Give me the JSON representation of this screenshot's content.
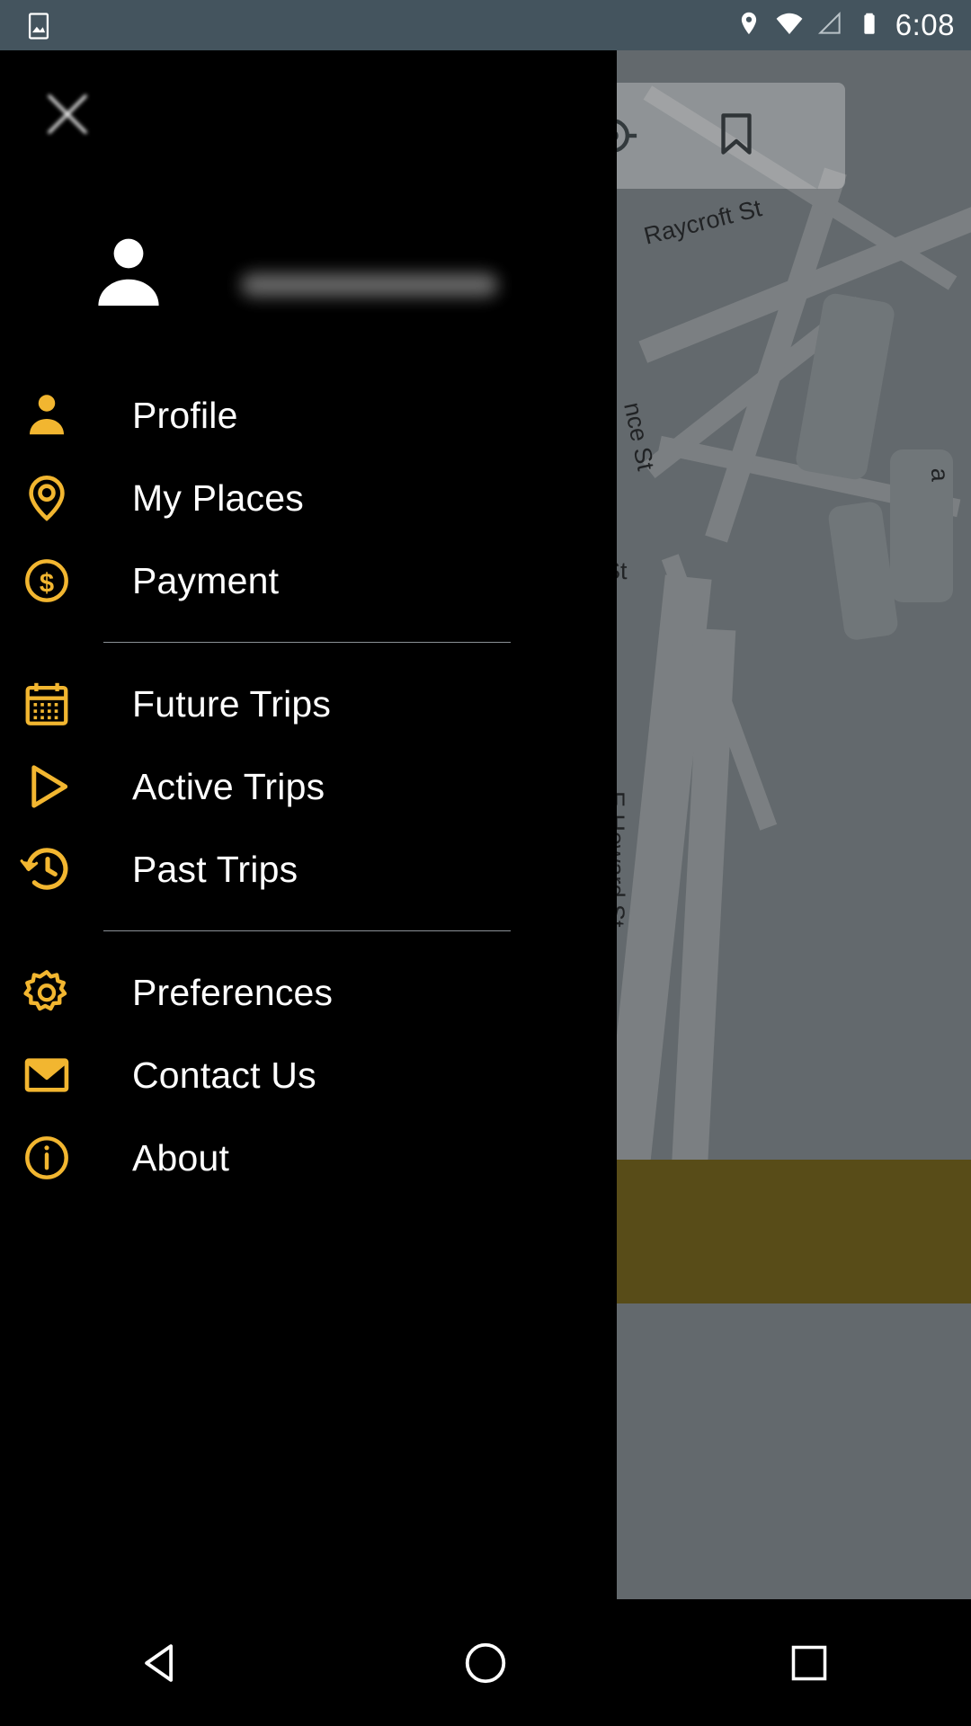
{
  "status_bar": {
    "time": "6:08",
    "left_icon": "screenshot-image-icon",
    "right_icons": [
      "location-pin-icon",
      "wifi-icon",
      "cell-signal-icon",
      "battery-icon"
    ],
    "background_color": "#44545e"
  },
  "drawer": {
    "background_color": "#000000",
    "accent_color": "#f2b630",
    "text_color": "#ffffff",
    "divider_color": "#8b9196",
    "close_icon": "close-x-icon",
    "profile": {
      "avatar_icon": "person-avatar-icon",
      "user_name": ""
    },
    "groups": [
      {
        "items": [
          {
            "label": "Profile",
            "icon": "person-icon"
          },
          {
            "label": "My Places",
            "icon": "map-pin-icon"
          },
          {
            "label": "Payment",
            "icon": "dollar-circle-icon"
          }
        ]
      },
      {
        "items": [
          {
            "label": "Future Trips",
            "icon": "calendar-icon"
          },
          {
            "label": "Active Trips",
            "icon": "play-triangle-icon"
          },
          {
            "label": "Past Trips",
            "icon": "history-clock-icon"
          }
        ]
      },
      {
        "items": [
          {
            "label": "Preferences",
            "icon": "gear-icon"
          },
          {
            "label": "Contact Us",
            "icon": "envelope-icon"
          },
          {
            "label": "About",
            "icon": "info-circle-icon"
          }
        ]
      }
    ]
  },
  "map": {
    "street_labels": [
      "Raycroft St",
      "nce St",
      "St",
      "E Howard St"
    ],
    "card_icons": [
      "gps-crosshair-icon",
      "bookmark-icon"
    ],
    "dim_overlay": true,
    "accent_strip_color": "#8a7315"
  },
  "nav_bar": {
    "buttons": [
      {
        "name": "back-button",
        "icon": "triangle-back-icon"
      },
      {
        "name": "home-button",
        "icon": "circle-home-icon"
      },
      {
        "name": "recents-button",
        "icon": "square-recents-icon"
      }
    ]
  }
}
